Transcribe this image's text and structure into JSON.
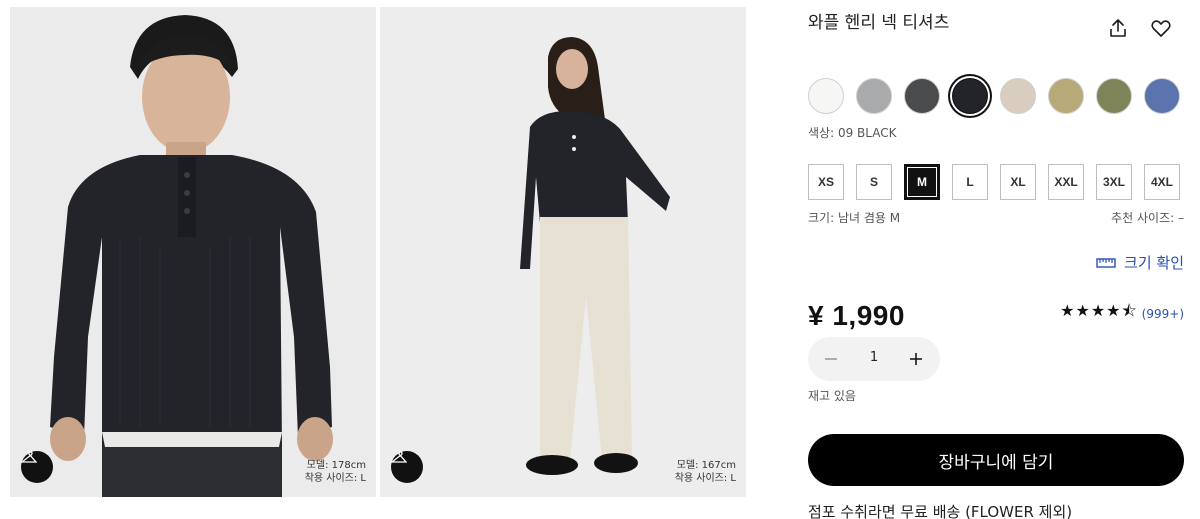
{
  "product": {
    "title": "와플 헨리 넥 티셔츠",
    "price": "¥ 1,990"
  },
  "icons": {
    "share": "share-icon",
    "favorite": "heart-icon",
    "hanger": "hanger-icon",
    "ruler": "ruler-icon",
    "minus": "minus-icon",
    "plus": "plus-icon"
  },
  "gallery": [
    {
      "model_height": "모델: 178cm",
      "model_size": "착용 사이즈: L"
    },
    {
      "model_height": "모델: 167cm",
      "model_size": "착용 사이즈: L"
    }
  ],
  "colors": {
    "swatches": [
      {
        "name": "white",
        "hex": "#f6f6f4",
        "selected": false
      },
      {
        "name": "light-gray",
        "hex": "#a9aaac",
        "selected": false
      },
      {
        "name": "dark-gray",
        "hex": "#4a4b4d",
        "selected": false
      },
      {
        "name": "black",
        "hex": "#22242a",
        "selected": true
      },
      {
        "name": "beige",
        "hex": "#d8cdbf",
        "selected": false
      },
      {
        "name": "khaki",
        "hex": "#b8a978",
        "selected": false
      },
      {
        "name": "olive",
        "hex": "#7f8458",
        "selected": false
      },
      {
        "name": "blue",
        "hex": "#5a73ad",
        "selected": false
      }
    ],
    "label": "색상: 09 BLACK"
  },
  "sizes": {
    "options": [
      "XS",
      "S",
      "M",
      "L",
      "XL",
      "XXL",
      "3XL",
      "4XL"
    ],
    "selected": "M",
    "label": "크기: 남녀 겸용 M",
    "recommend": "추천 사이즈: –",
    "guide": "크기 확인"
  },
  "rating": {
    "stars": "★★★★⯪",
    "count": "(999+)",
    "value": 4.5
  },
  "quantity": {
    "value": "1"
  },
  "stock": "재고 있음",
  "cart_button": "장바구니에 담기",
  "pickup": "점포 수취라면 무료 배송 (FLOWER 제외)"
}
